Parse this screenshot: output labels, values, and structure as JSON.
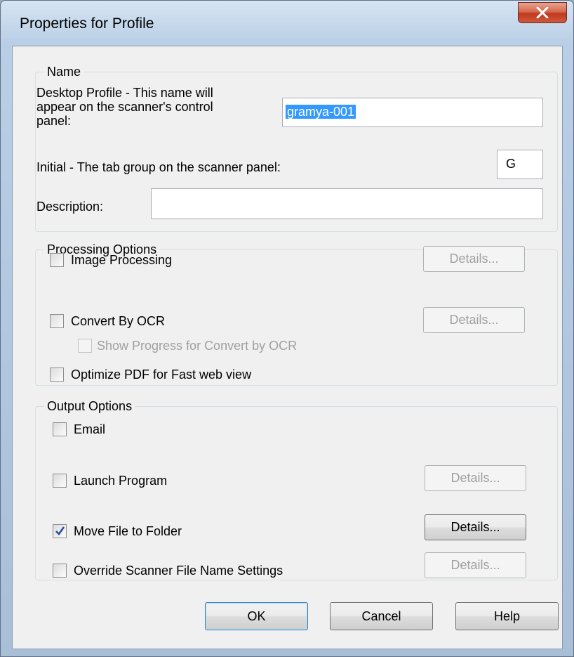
{
  "window": {
    "title": "Properties for Profile"
  },
  "name_group": {
    "legend": "Name",
    "desktop_profile_label": [
      "Desktop Profile - This name will",
      "appear on the scanner's control",
      "panel:"
    ],
    "desktop_profile_value": "gramya-001",
    "initial_label": "Initial - The tab group on the scanner panel:",
    "initial_value": "G",
    "description_label": "Description:",
    "description_value": ""
  },
  "processing_group": {
    "legend": "Processing Options",
    "image_processing": {
      "label": "Image Processing",
      "checked": false,
      "details": "Details..."
    },
    "convert_ocr": {
      "label": "Convert By OCR",
      "checked": false,
      "details": "Details..."
    },
    "show_progress": {
      "label": "Show Progress for Convert by OCR",
      "checked": false
    },
    "optimize_pdf": {
      "label": "Optimize PDF for Fast web view",
      "checked": false
    }
  },
  "output_group": {
    "legend": "Output Options",
    "email": {
      "label": "Email",
      "checked": false
    },
    "launch_program": {
      "label": "Launch Program",
      "checked": false,
      "details": "Details..."
    },
    "move_file": {
      "label": "Move File to Folder",
      "checked": true,
      "details": "Details..."
    },
    "override_filename": {
      "label": "Override Scanner File Name Settings",
      "checked": false,
      "details": "Details..."
    }
  },
  "buttons": {
    "ok": "OK",
    "cancel": "Cancel",
    "help": "Help"
  },
  "colors": {
    "selection": "#3399ff",
    "dialog_bg": "#f0f0f0",
    "close_red": "#c0391f"
  },
  "icons": {
    "close": "close-icon",
    "check": "checkmark-icon"
  }
}
